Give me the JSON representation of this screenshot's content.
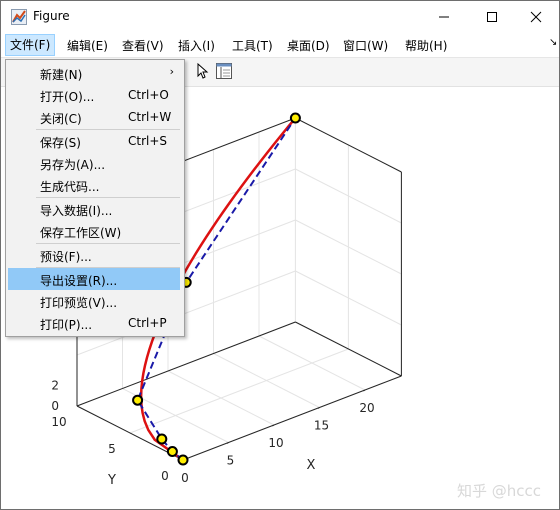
{
  "window": {
    "title": "Figure"
  },
  "menubar": {
    "items": [
      "文件(F)",
      "编辑(E)",
      "查看(V)",
      "插入(I)",
      "工具(T)",
      "桌面(D)",
      "窗口(W)",
      "帮助(H)"
    ]
  },
  "file_menu": {
    "items": [
      {
        "label": "新建(N)",
        "shortcut": "",
        "submenu": "›"
      },
      {
        "label": "打开(O)...",
        "shortcut": "Ctrl+O"
      },
      {
        "label": "关闭(C)",
        "shortcut": "Ctrl+W"
      },
      {
        "label": "保存(S)",
        "shortcut": "Ctrl+S"
      },
      {
        "label": "另存为(A)...",
        "shortcut": ""
      },
      {
        "label": "生成代码...",
        "shortcut": ""
      },
      {
        "label": "导入数据(I)...",
        "shortcut": ""
      },
      {
        "label": "保存工作区(W)",
        "shortcut": ""
      },
      {
        "label": "预设(F)...",
        "shortcut": ""
      },
      {
        "label": "导出设置(R)...",
        "shortcut": ""
      },
      {
        "label": "打印预览(V)...",
        "shortcut": ""
      },
      {
        "label": "打印(P)...",
        "shortcut": "Ctrl+P"
      }
    ]
  },
  "chart_data": {
    "type": "line",
    "xlabel": "X",
    "ylabel": "Y",
    "x_ticks": [
      "0",
      "5",
      "10",
      "15",
      "20"
    ],
    "y_ticks": [
      "0",
      "5",
      "10"
    ],
    "z_ticks": [
      "0",
      "2"
    ],
    "series": [
      {
        "style": "red-solid",
        "color": "#dd1111"
      },
      {
        "style": "blue-dashed-circle-markers",
        "color": "#1a1aa8",
        "marker_fill": "#ffee00"
      }
    ],
    "marker_points": [
      [
        0,
        0,
        0
      ],
      [
        0,
        1,
        0.3
      ],
      [
        0,
        2,
        1
      ],
      [
        2,
        6,
        2
      ],
      [
        12,
        10,
        8
      ],
      [
        24,
        10,
        20
      ]
    ],
    "grid": true
  },
  "watermark": "知乎 @hccc",
  "icons": {
    "app": "matlab-figure-icon",
    "minimize": "minimize-icon",
    "maximize": "maximize-icon",
    "close": "close-icon",
    "pointer": "pointer-icon",
    "property-inspector": "property-inspector-icon"
  }
}
